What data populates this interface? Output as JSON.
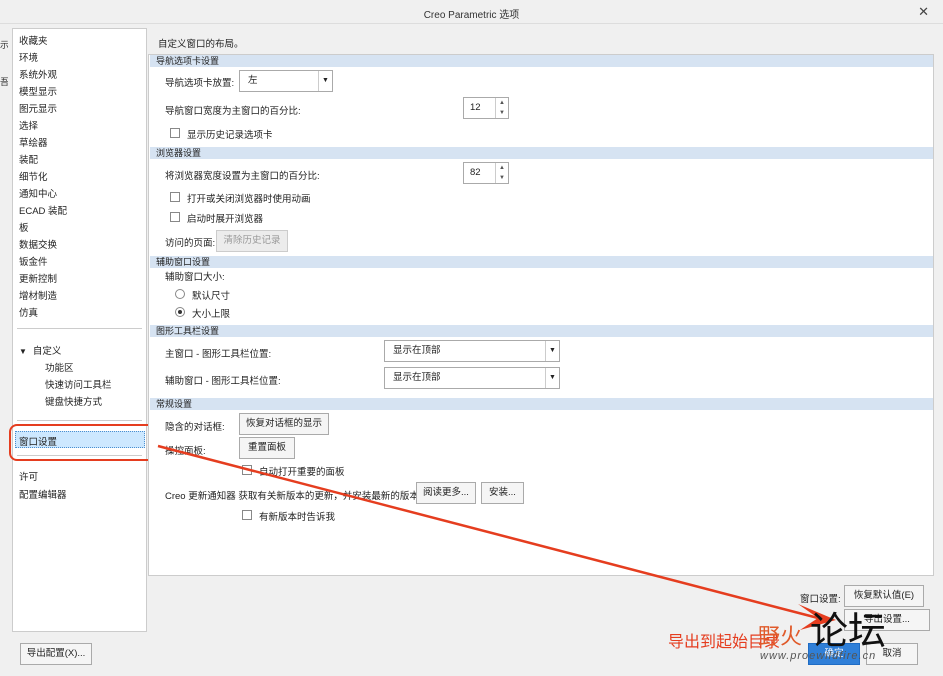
{
  "window": {
    "title": "Creo Parametric 选项"
  },
  "edge": {
    "c1": "示",
    "c2": "吾"
  },
  "nav": {
    "items": [
      "收藏夹",
      "环境",
      "系统外观",
      "模型显示",
      "图元显示",
      "选择",
      "草绘器",
      "装配",
      "细节化",
      "通知中心",
      "ECAD 装配",
      "板",
      "数据交换",
      "钣金件",
      "更新控制",
      "增材制造",
      "仿真"
    ],
    "customize": "自定义",
    "customize_children": [
      "功能区",
      "快速访问工具栏",
      "键盘快捷方式"
    ],
    "window_settings": "窗口设置",
    "license": "许可",
    "config_editor": "配置编辑器"
  },
  "main": {
    "description": "自定义窗口的布局。",
    "sec_nav": "导航选项卡设置",
    "nav_pos_label": "导航选项卡放置:",
    "nav_pos_value": "左",
    "nav_width_label": "导航窗口宽度为主窗口的百分比:",
    "nav_width_value": "12",
    "show_history": "显示历史记录选项卡",
    "sec_browser": "浏览器设置",
    "browser_width_label": "将浏览器宽度设置为主窗口的百分比:",
    "browser_width_value": "82",
    "anim": "打开或关闭浏览器时使用动画",
    "expand": "启动时展开浏览器",
    "visited_label": "访问的页面:",
    "clear_history": "清除历史记录",
    "sec_aux": "辅助窗口设置",
    "aux_size_label": "辅助窗口大小:",
    "default_size": "默认尺寸",
    "max_size": "大小上限",
    "sec_toolbar": "图形工具栏设置",
    "main_tb_label": "主窗口 - 图形工具栏位置:",
    "main_tb_value": "显示在顶部",
    "aux_tb_label": "辅助窗口 - 图形工具栏位置:",
    "aux_tb_value": "显示在顶部",
    "sec_general": "常规设置",
    "hidden_dlg_label": "隐含的对话框:",
    "restore_dlg": "恢复对话框的显示",
    "panel_label": "操控面板:",
    "reset_panel": "重置面板",
    "auto_open": "自动打开重要的面板",
    "creo_notifier": "Creo 更新通知器 获取有关新版本的更新，并安装最新的版本",
    "read_more": "阅读更多...",
    "install": "安装...",
    "notify_new": "有新版本时告诉我"
  },
  "footer": {
    "window_settings_label": "窗口设置:",
    "restore_defaults": "恢复默认值(E)",
    "export": "导出设置...",
    "export_config": "导出配置(X)...",
    "ok": "确定",
    "cancel": "取消"
  },
  "annotation": {
    "text": "导出到起始目录"
  },
  "watermark": {
    "brand": "野火",
    "forum": "论坛",
    "url": "www.proewildfire.cn"
  },
  "colors": {
    "annotation": "#e53d1f",
    "section_header": "#d6e3f2",
    "selected": "#cde8ff"
  }
}
